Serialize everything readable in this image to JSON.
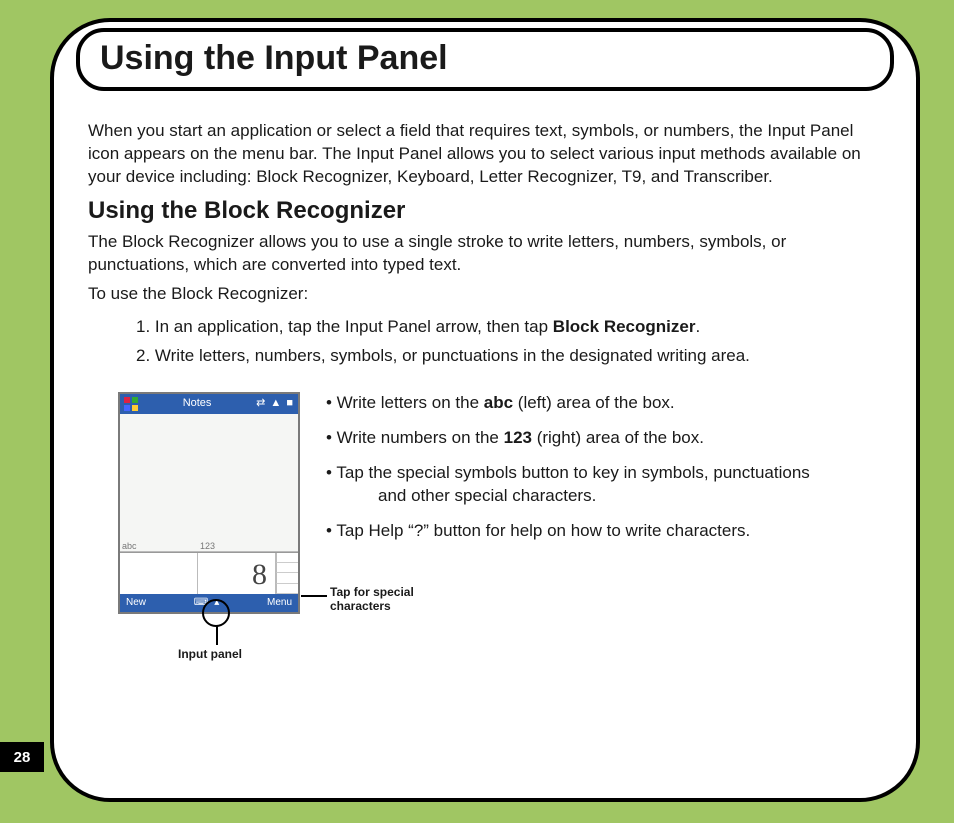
{
  "page_number": "28",
  "title": "Using the Input Panel",
  "intro": "When you start an application or select a field that requires text, symbols, or numbers, the Input Panel icon appears on the menu bar. The Input Panel allows you to select various input methods available on your device including: Block Recognizer, Keyboard, Letter Recognizer, T9, and Transcriber.",
  "section_heading": "Using the Block Recognizer",
  "section_intro": "The Block Recognizer allows you to use a single stroke to write letters, numbers, symbols, or punctuations, which are converted into typed text.",
  "section_lead": "To use the Block Recognizer:",
  "steps": {
    "s1_pre": "1. In an application, tap the Input Panel arrow, then tap ",
    "s1_bold": "Block Recognizer",
    "s1_post": ".",
    "s2": "2. Write letters, numbers, symbols, or punctuations in the designated writing area."
  },
  "bullets": {
    "b1_pre": "• Write letters on the ",
    "b1_bold": "abc",
    "b1_post": " (left) area of the box.",
    "b2_pre": "• Write numbers on the ",
    "b2_bold": "123",
    "b2_post": " (right) area of the box.",
    "b3_line1": "• Tap the special symbols button to key in symbols, punctuations",
    "b3_line2": "and other special characters.",
    "b4": "• Tap Help “?” button for help on how to write characters."
  },
  "screenshot": {
    "app_title": "Notes",
    "status_icons": "⇄ ▲ ■",
    "zone_left_label": "abc",
    "zone_right_label": "123",
    "drawn_char": "8",
    "bottom_left": "New",
    "bottom_right": "Menu"
  },
  "annotations": {
    "input_panel": "Input panel",
    "special_chars": "Tap for special characters"
  }
}
